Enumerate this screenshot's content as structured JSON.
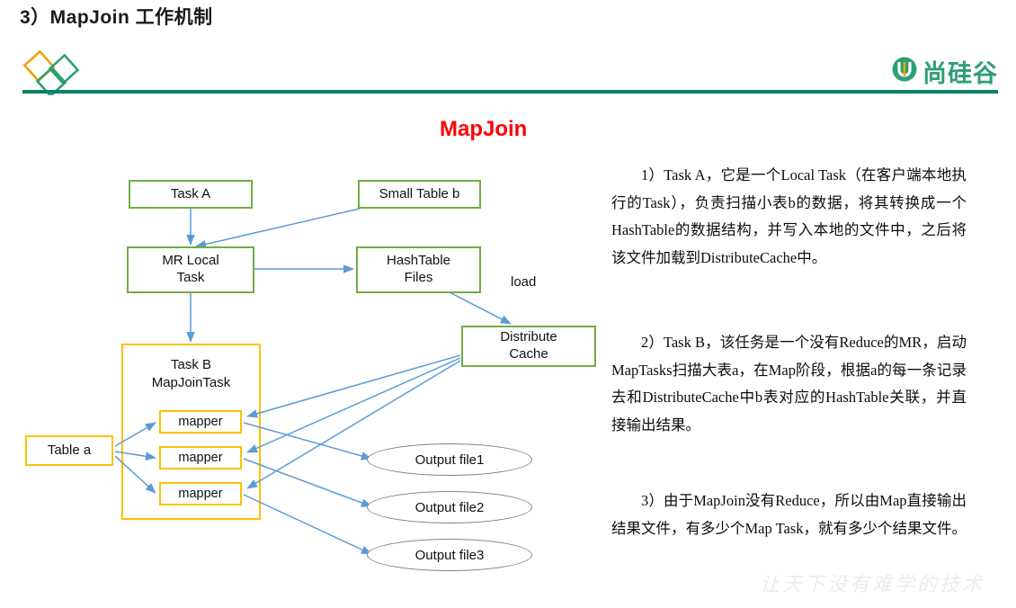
{
  "header": {
    "title": "3）MapJoin 工作机制",
    "brand_name": "尚硅谷",
    "brand_color": "#2e9e74",
    "rule_color": "#0d8068",
    "diamond_colors": [
      "#f0a500",
      "#2e9e74",
      "#2e9e74"
    ]
  },
  "diagram": {
    "title": "MapJoin",
    "title_color": "#ff0000",
    "green_border": "#70ad47",
    "orange_border": "#ffc000",
    "arrow_color": "#5b9bd5",
    "ellipse_border": "#808080",
    "nodes": {
      "task_a": "Task A",
      "small_table_b": "Small Table b",
      "mr_local_task": "MR Local\nTask",
      "hashtable_files": "HashTable\nFiles",
      "distribute_cache": "Distribute\nCache",
      "task_b_group": "Task B\nMapJoinTask",
      "table_a": "Table a",
      "mapper_1": "mapper",
      "mapper_2": "mapper",
      "mapper_3": "mapper",
      "output_file_1": "Output file1",
      "output_file_2": "Output file2",
      "output_file_3": "Output file3"
    },
    "edge_labels": {
      "load": "load"
    }
  },
  "notes": {
    "para1": "1）Task A，它是一个Local Task（在客户端本地执行的Task），负责扫描小表b的数据，将其转换成一个HashTable的数据结构，并写入本地的文件中，之后将该文件加载到DistributeCache中。",
    "para2": "2）Task B，该任务是一个没有Reduce的MR，启动MapTasks扫描大表a，在Map阶段，根据a的每一条记录去和DistributeCache中b表对应的HashTable关联，并直接输出结果。",
    "para3": "3）由于MapJoin没有Reduce，所以由Map直接输出结果文件，有多少个Map Task，就有多少个结果文件。"
  },
  "watermark": {
    "text": "让天下没有难学的技术"
  }
}
